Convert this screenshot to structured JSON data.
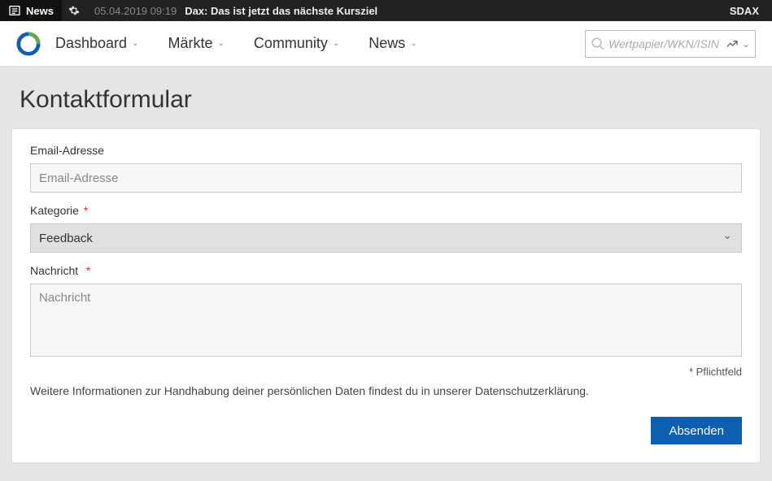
{
  "ticker": {
    "news_label": "News",
    "date": "05.04.2019 09:19",
    "headline": "Dax: Das ist jetzt das nächste Kursziel",
    "right": "SDAX"
  },
  "nav": {
    "items": [
      {
        "label": "Dashboard"
      },
      {
        "label": "Märkte"
      },
      {
        "label": "Community"
      },
      {
        "label": "News"
      }
    ],
    "search_placeholder": "Wertpapier/WKN/ISIN"
  },
  "page": {
    "title": "Kontaktformular"
  },
  "form": {
    "email_label": "Email-Adresse",
    "email_placeholder": "Email-Adresse",
    "category_label": "Kategorie",
    "category_value": "Feedback",
    "message_label": "Nachricht",
    "message_placeholder": "Nachricht",
    "required_note": "* Pflichtfeld",
    "privacy_note": "Weitere Informationen zur Handhabung deiner persönlichen Daten findest du in unserer Datenschutzerklärung.",
    "submit_label": "Absenden"
  }
}
